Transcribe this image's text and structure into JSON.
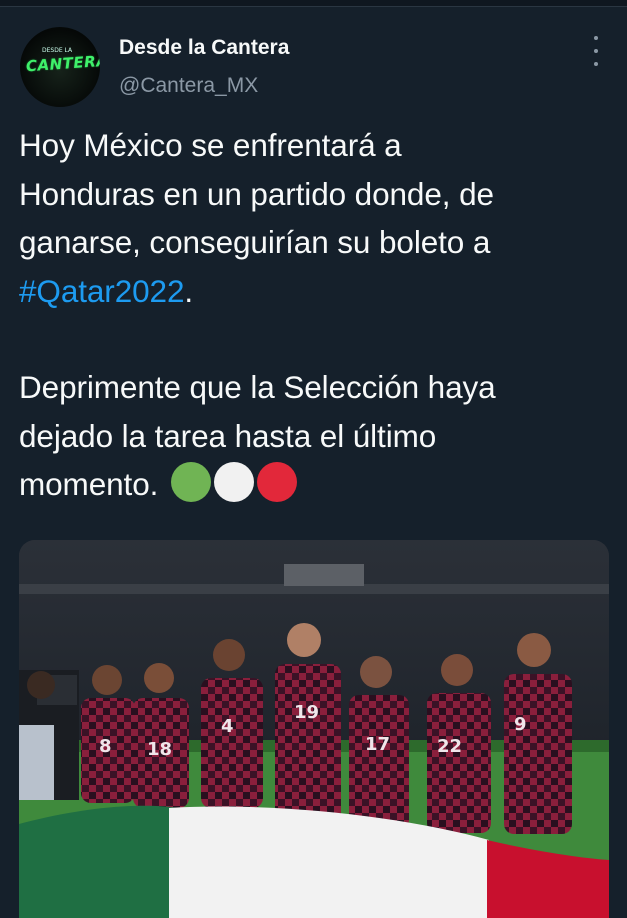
{
  "account": {
    "display_name": "Desde la Cantera",
    "handle": "@Cantera_MX",
    "avatar_logo_text": "CANTERA",
    "avatar_logo_top": "DESDE LA"
  },
  "tweet": {
    "line1": "Hoy México se enfrentará a",
    "line2": "Honduras en un partido donde, de",
    "line3": "ganarse, conseguirían su boleto a",
    "hashtag": "#Qatar2022",
    "hashtag_after": ".",
    "line5": "Deprimente que la Selección haya",
    "line6": "dejado la tarea hasta el último",
    "line7": "momento.",
    "emoji_dots": [
      "green-circle",
      "white-circle",
      "red-circle"
    ]
  },
  "media": {
    "jersey_numbers": [
      "8",
      "18",
      "4",
      "19",
      "17",
      "22",
      "9"
    ],
    "flag_colors": [
      "#1f6f43",
      "#f2f2f2",
      "#c8102e"
    ]
  },
  "colors": {
    "background": "#15202b",
    "text": "#f7f9f9",
    "secondary": "#8b98a5",
    "link": "#1d9bf0",
    "jersey": "#8a1f3c"
  },
  "icons": {
    "more": "more-vertical-icon"
  }
}
